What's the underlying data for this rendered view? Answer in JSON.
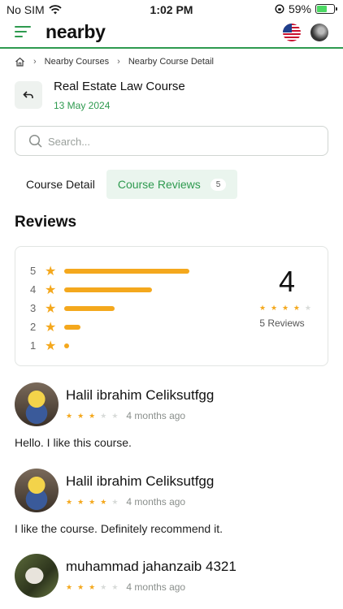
{
  "status_bar": {
    "carrier": "No SIM",
    "time": "1:02 PM",
    "battery": "59%"
  },
  "header": {
    "brand": "nearby"
  },
  "breadcrumb": {
    "items": [
      "Nearby Courses",
      "Nearby Course Detail"
    ]
  },
  "page": {
    "title": "Real Estate Law Course",
    "date": "13 May 2024"
  },
  "search": {
    "placeholder": "Search...",
    "value": ""
  },
  "tabs": [
    {
      "label": "Course Detail",
      "active": false
    },
    {
      "label": "Course Reviews",
      "active": true,
      "count": "5"
    }
  ],
  "reviews_section": {
    "title": "Reviews",
    "summary": {
      "average": "4",
      "average_rating": 4,
      "count_label": "5 Reviews",
      "distribution": [
        {
          "stars": "5",
          "share": 1.0
        },
        {
          "stars": "4",
          "share": 0.7
        },
        {
          "stars": "3",
          "share": 0.4
        },
        {
          "stars": "2",
          "share": 0.13
        },
        {
          "stars": "1",
          "share": 0.04
        }
      ]
    },
    "items": [
      {
        "name": "Halil ibrahim Celiksutfgg",
        "rating": 3,
        "time": "4 months ago",
        "text": "Hello. I like this course.",
        "avatar_icon": "minion-avatar"
      },
      {
        "name": "Halil ibrahim Celiksutfgg",
        "rating": 4,
        "time": "4 months ago",
        "text": "I like the course. Definitely recommend it.",
        "avatar_icon": "minion-avatar"
      },
      {
        "name": "muhammad jahanzaib 4321",
        "rating": 3,
        "time": "4 months ago",
        "text": "",
        "avatar_icon": "plant-avatar"
      }
    ]
  },
  "colors": {
    "accent": "#2e9a4f",
    "star": "#f4a81d",
    "star_off": "#d8dbd9"
  }
}
